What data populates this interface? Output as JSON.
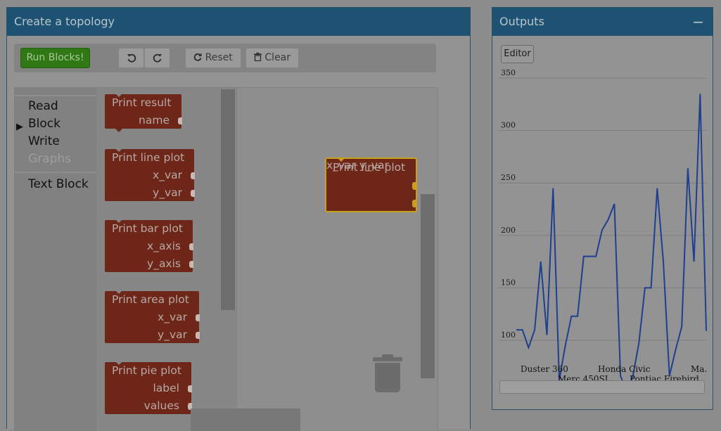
{
  "topology_panel": {
    "title": "Create a topology",
    "toolbar": {
      "run_label": "Run Blocks!",
      "undo_icon": "undo-icon",
      "redo_icon": "redo-icon",
      "reset_label": "Reset",
      "clear_label": "Clear"
    },
    "toolbox": {
      "categories": [
        "Read",
        "Block",
        "Write",
        "Graphs",
        "Text Block"
      ],
      "expanded_category": "Block"
    },
    "flyout_blocks": [
      {
        "title": "Print result",
        "inputs": [
          "name"
        ]
      },
      {
        "title": "Print line plot",
        "inputs": [
          "x_var",
          "y_var"
        ]
      },
      {
        "title": "Print bar plot",
        "inputs": [
          "x_axis",
          "y_axis"
        ]
      },
      {
        "title": "Print area plot",
        "inputs": [
          "x_var",
          "y_var"
        ]
      },
      {
        "title": "Print pie plot",
        "inputs": [
          "label",
          "values"
        ]
      }
    ],
    "workspace_block": {
      "title": "Print line plot",
      "inputs": [
        "x_var",
        "y_var"
      ]
    }
  },
  "outputs_panel": {
    "title": "Outputs",
    "minimize_label": "−",
    "editor_label": "Editor"
  },
  "colors": {
    "header": "#1e5273",
    "block": "#6e2618",
    "run_button": "#307814",
    "selected_outline": "#c9a01a",
    "line": "#1f3f8f"
  },
  "chart_data": {
    "type": "line",
    "ylim": [
      100,
      350
    ],
    "yticks": [
      100,
      150,
      200,
      250,
      300,
      350
    ],
    "x_tick_labels": [
      "Duster 360",
      "Merc 450SL",
      "Honda Civic",
      "Pontiac Firebird",
      "Ma..."
    ],
    "values": [
      110,
      110,
      93,
      110,
      175,
      105,
      245,
      62,
      95,
      123,
      123,
      180,
      180,
      180,
      205,
      215,
      230,
      66,
      52,
      65,
      97,
      150,
      150,
      245,
      175,
      66,
      91,
      113,
      264,
      175,
      335,
      109
    ]
  }
}
